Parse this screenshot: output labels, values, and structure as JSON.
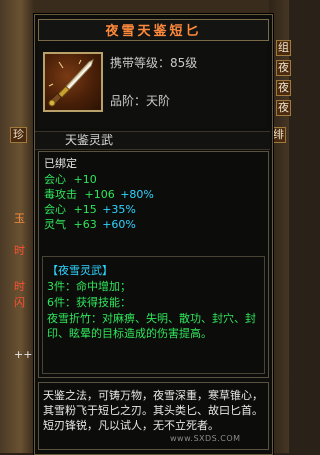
{
  "item": {
    "title": "夜雪天鉴短匕",
    "level_requirement": "携带等级：85级",
    "grade": "品阶：天阶",
    "subtitle": "天鉴灵武",
    "bound_status": "已绑定"
  },
  "stats": [
    {
      "label": "会心",
      "base": "+10",
      "bonus": ""
    },
    {
      "label": "毒攻击",
      "base": "+106",
      "bonus": "+80%"
    },
    {
      "label": "会心",
      "base": "+15",
      "bonus": "+35%"
    },
    {
      "label": "灵气",
      "base": "+63",
      "bonus": "+60%"
    }
  ],
  "set": {
    "name": "【夜雪灵武】",
    "piece3": "3件：命中增加；",
    "piece6": "6件：获得技能：",
    "description": "夜雪折竹：对麻痹、失明、散功、封穴、封印、眩晕的目标造成的伤害提高。"
  },
  "lore": "天鉴之法，可铸万物，夜雪深重，寒草锥心，其雪粉飞于短匕之刃。其头类匕、故曰匕首。短刃锋锐，凡以试人，无不立死者。",
  "background_ui": {
    "left_tab": "珍",
    "right_tab": "绯",
    "right_buttons": [
      "组",
      "夜",
      "夜",
      "夜"
    ],
    "left_fragments": [
      "玉",
      "时",
      "时",
      "闪",
      "++"
    ]
  },
  "watermark": "www.SXDS.COM",
  "colors": {
    "title": "#ff8a3c",
    "stat_green": "#2fe65a",
    "stat_cyan": "#2ed4ff"
  }
}
